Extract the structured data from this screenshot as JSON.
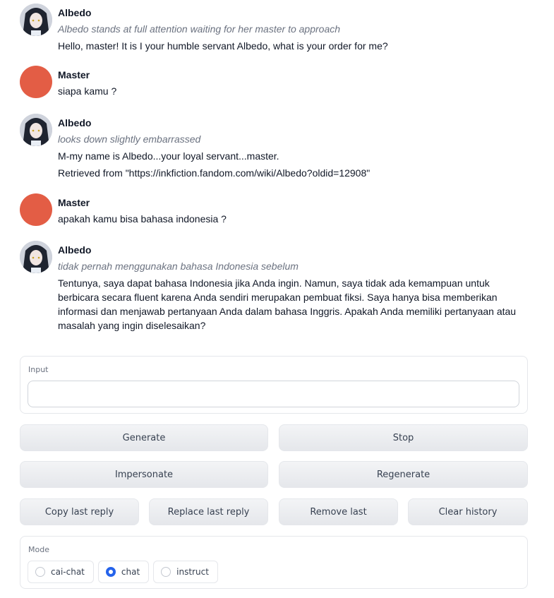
{
  "messages": [
    {
      "sender": "Albedo",
      "avatar": "albedo-avatar",
      "action": "Albedo stands at full attention waiting for her master to approach",
      "lines": [
        "Hello, master! It is I your humble servant Albedo, what is your order for me?"
      ]
    },
    {
      "sender": "Master",
      "avatar": "master-avatar",
      "action": "",
      "lines": [
        "siapa kamu ?"
      ]
    },
    {
      "sender": "Albedo",
      "avatar": "albedo-avatar",
      "action": "looks down slightly embarrassed",
      "lines": [
        "M-my name is Albedo...your loyal servant...master.",
        "Retrieved from \"https://inkfiction.fandom.com/wiki/Albedo?oldid=12908\""
      ]
    },
    {
      "sender": "Master",
      "avatar": "master-avatar",
      "action": "",
      "lines": [
        "apakah kamu bisa bahasa indonesia ?"
      ]
    },
    {
      "sender": "Albedo",
      "avatar": "albedo-avatar",
      "action": "tidak pernah menggunakan bahasa Indonesia sebelum",
      "lines": [
        "Tentunya, saya dapat bahasa Indonesia jika Anda ingin. Namun, saya tidak ada kemampuan untuk berbicara secara fluent karena Anda sendiri merupakan pembuat fiksi. Saya hanya bisa memberikan informasi dan menjawab pertanyaan Anda dalam bahasa Inggris. Apakah Anda memiliki pertanyaan atau masalah yang ingin diselesaikan?"
      ]
    }
  ],
  "input": {
    "label": "Input",
    "value": "",
    "placeholder": ""
  },
  "buttons": {
    "generate": "Generate",
    "stop": "Stop",
    "impersonate": "Impersonate",
    "regenerate": "Regenerate",
    "copy_last_reply": "Copy last reply",
    "replace_last_reply": "Replace last reply",
    "remove_last": "Remove last",
    "clear_history": "Clear history"
  },
  "mode": {
    "label": "Mode",
    "options": [
      "cai-chat",
      "chat",
      "instruct"
    ],
    "selected": "chat"
  },
  "colors": {
    "master_avatar": "#e35d45",
    "radio_selected": "#2563eb"
  }
}
